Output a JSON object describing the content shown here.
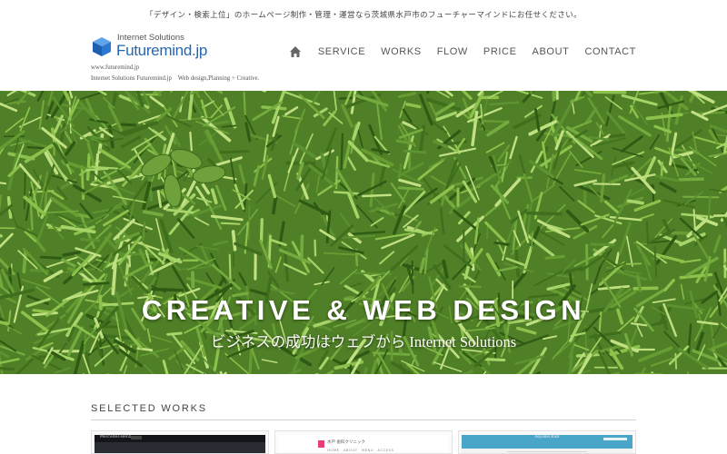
{
  "header": {
    "tagline": "「デザイン・検索上位」のホームページ制作・管理・運営なら茨城県水戸市のフューチャーマインドにお任せください。",
    "logo": {
      "subtitle": "Internet Solutions",
      "name": "Futuremind",
      "suffix": ".jp"
    },
    "site_url": "www.futuremind.jp",
    "site_description": "Internet Solutions Futuremind.jp　Web design,Planning + Creative."
  },
  "nav": {
    "home_icon": "home-icon",
    "items": [
      "SERVICE",
      "WORKS",
      "FLOW",
      "PRICE",
      "ABOUT",
      "CONTACT"
    ]
  },
  "hero": {
    "title": "CREATIVE & WEB DESIGN",
    "subtitle": "ビジネスの成功はウェブから Internet Solutions"
  },
  "works": {
    "title": "SELECTED WORKS",
    "thumbnails": [
      {
        "label": "Mercedes-Benz"
      },
      {
        "label": "水戸 歯科クリニック",
        "menu": "HOME　ABOUT　MENU　ACCESS"
      },
      {
        "label": "Aoyama Kids"
      }
    ]
  },
  "colors": {
    "brand_blue": "#2466b3",
    "nav_text": "#555555",
    "hero_green": "#5e9030",
    "accent_pink": "#e83d7b",
    "accent_teal": "#4aa6c9"
  }
}
